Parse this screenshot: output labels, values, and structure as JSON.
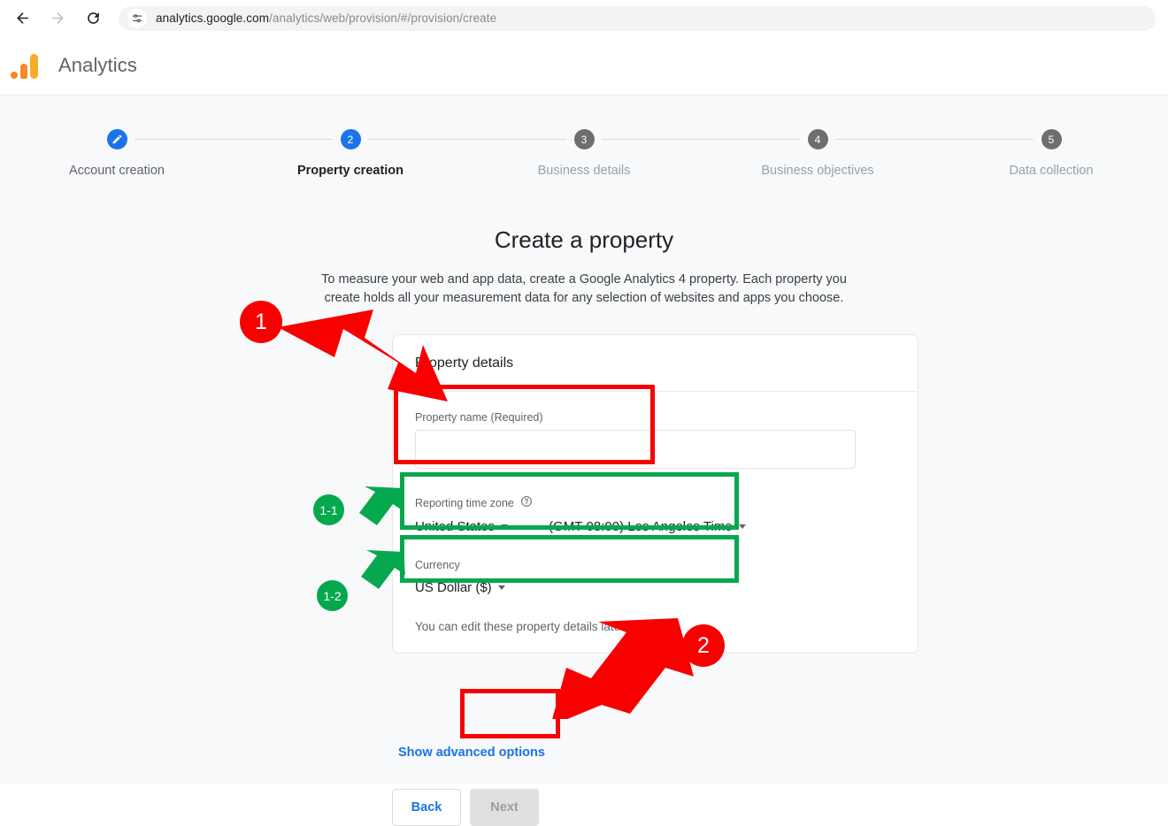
{
  "browser": {
    "back_icon": "arrow-left-icon",
    "forward_icon": "arrow-right-icon",
    "reload_icon": "reload-icon",
    "site_settings_icon": "tune-icon",
    "url_domain": "analytics.google.com",
    "url_path": "/analytics/web/provision/#/provision/create"
  },
  "app": {
    "logo_icon": "google-analytics-logo",
    "title": "Analytics"
  },
  "stepper": {
    "steps": [
      {
        "number": "1",
        "glyph": "pencil-icon",
        "label": "Account creation",
        "state": "done"
      },
      {
        "number": "2",
        "glyph": "2",
        "label": "Property creation",
        "state": "active"
      },
      {
        "number": "3",
        "glyph": "3",
        "label": "Business details",
        "state": "future"
      },
      {
        "number": "4",
        "glyph": "4",
        "label": "Business objectives",
        "state": "future"
      },
      {
        "number": "5",
        "glyph": "5",
        "label": "Data collection",
        "state": "future"
      }
    ]
  },
  "main": {
    "heading": "Create a property",
    "description": "To measure your web and app data, create a Google Analytics 4 property. Each property you create holds all your measurement data for any selection of websites and apps you choose.",
    "card_title": "Property details",
    "property_name": {
      "label": "Property name (Required)",
      "value": "",
      "placeholder": ""
    },
    "reporting_time_zone": {
      "label": "Reporting time zone",
      "help_icon": "help-circle-icon",
      "country": "United States",
      "zone": "(GMT-08:00) Los Angeles Time"
    },
    "currency": {
      "label": "Currency",
      "value": "US Dollar ($)"
    },
    "helper_note": "You can edit these property details later in Admin",
    "advanced_link": "Show advanced options",
    "back_button": "Back",
    "next_button": "Next"
  },
  "annotations": {
    "badge_1": "1",
    "badge_1_1": "1-1",
    "badge_1_2": "1-2",
    "badge_2": "2",
    "red": "#f80000",
    "green": "#06a84e"
  },
  "colors": {
    "accent_blue": "#1a73e8",
    "page_bg": "#f8f9fa",
    "logo_orange": "#f5882c",
    "logo_amber": "#f9ab28"
  }
}
